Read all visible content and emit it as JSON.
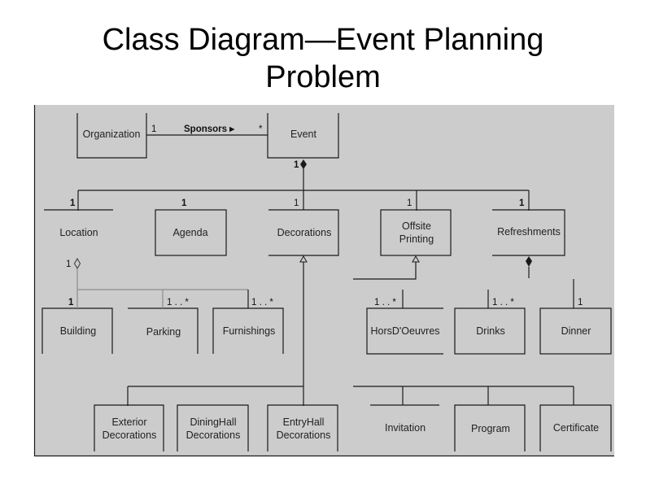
{
  "title": {
    "line1": "Class Diagram—Event Planning",
    "line2": "Problem"
  },
  "colors": {
    "panel_bg": "#cccccc",
    "line": "#1a1a1a",
    "aggregation_line": "#8c8c8c",
    "title_text": "#000000"
  },
  "diagram": {
    "classes": {
      "organization": "Organization",
      "event": "Event",
      "location": "Location",
      "agenda": "Agenda",
      "decorations": "Decorations",
      "offsite_printing_1": "Offsite",
      "offsite_printing_2": "Printing",
      "refreshments": "Refreshments",
      "building": "Building",
      "parking": "Parking",
      "furnishings": "Furnishings",
      "horsdoeuvres": "HorsD'Oeuvres",
      "drinks": "Drinks",
      "dinner": "Dinner",
      "exterior_decorations_1": "Exterior",
      "exterior_decorations_2": "Decorations",
      "dininghall_decorations_1": "DiningHall",
      "dininghall_decorations_2": "Decorations",
      "entryhall_decorations_1": "EntryHall",
      "entryhall_decorations_2": "Decorations",
      "invitation": "Invitation",
      "program": "Program",
      "certificate": "Certificate"
    },
    "association": {
      "label": "Sponsors ▸",
      "org_multiplicity": "1",
      "event_multiplicity": "*"
    },
    "multiplicities": {
      "event_composition": "1",
      "location": "1",
      "agenda": "1",
      "decorations": "1",
      "offsite_printing": "1",
      "refreshments": "1",
      "location_aggregation": "1",
      "building": "1",
      "parking": "1 . . *",
      "furnishings": "1 . . *",
      "horsdoeuvres": "1 . . *",
      "drinks": "1 . . *",
      "dinner": "1"
    }
  }
}
